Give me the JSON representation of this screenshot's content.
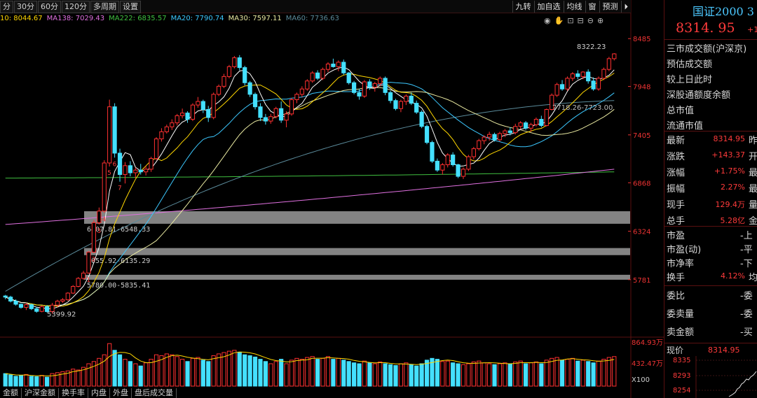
{
  "toolbar": {
    "left_buttons": [
      "分",
      "30分",
      "60分",
      "120分",
      "多周期",
      "设置"
    ],
    "right_buttons": [
      "九转",
      "加自选",
      "均线",
      "窗",
      "预测",
      "⏵"
    ]
  },
  "ma_legend": [
    {
      "label": "10: 8044.67",
      "color": "#ffd700"
    },
    {
      "label": "MA138: 7029.43",
      "color": "#e070e0"
    },
    {
      "label": "MA222: 6835.57",
      "color": "#40c040"
    },
    {
      "label": "MA20: 7790.74",
      "color": "#3cc8ff"
    },
    {
      "label": "MA30: 7597.11",
      "color": "#e8e8a0"
    },
    {
      "label": "MA60: 7736.63",
      "color": "#5a8a9a"
    }
  ],
  "chart_icons": [
    "eye-icon",
    "hand-icon",
    "lock-icon",
    "shrink-icon",
    "zoom-out-icon",
    "zoom-in-icon"
  ],
  "price_axis": [
    "8485",
    "7948",
    "7405",
    "6868",
    "6324",
    "5781"
  ],
  "volume_axis": [
    "864.93万",
    "432.47万",
    "X100"
  ],
  "annotations": {
    "high": "8322.23",
    "low": "5399.92",
    "gap1": "6407.81-6548.33",
    "gap2": "6055.92-6135.29",
    "gap3": "5780.00-5835.41",
    "gap_top": "7718.26-7723.00"
  },
  "bottom_tabs": [
    "金额",
    "沪深金额",
    "换手率",
    "内盘",
    "外盘",
    "盘后成交量"
  ],
  "panel": {
    "title": "国证2000 3",
    "price": "8314. 95",
    "change_small": "+1",
    "rows_top": [
      "三市成交额(沪深京)",
      "预估成交额",
      "较上日此时",
      "深股通额度余额",
      "总市值",
      "流通市值"
    ],
    "quote_rows": [
      {
        "label": "最新",
        "value": "8314.95",
        "tail": "昨"
      },
      {
        "label": "涨跌",
        "value": "+143.37",
        "tail": "开"
      },
      {
        "label": "涨幅",
        "value": "+1.75%",
        "tail": "最"
      },
      {
        "label": "振幅",
        "value": "2.27%",
        "tail": "最"
      },
      {
        "label": "现手",
        "value": "129.4万",
        "tail": "量"
      },
      {
        "label": "总手",
        "value": "5.28亿",
        "tail": "金"
      }
    ],
    "ratio_rows": [
      {
        "label": "市盈",
        "tail": "上"
      },
      {
        "label": "市盈(动)",
        "tail": "平"
      },
      {
        "label": "市净率",
        "tail": "下"
      },
      {
        "label": "换手",
        "value": "4.12%",
        "tail": "均"
      }
    ],
    "order_rows": [
      {
        "label": "委比",
        "tail": "委"
      },
      {
        "label": "委卖量",
        "tail": "委"
      },
      {
        "label": "卖金额",
        "tail": "买"
      }
    ],
    "mini": {
      "label": "现价",
      "value": "8314.95",
      "axis": [
        "8335",
        "8293",
        "8254"
      ]
    }
  },
  "chart_data": {
    "type": "candlestick",
    "price_range": [
      5230,
      8620
    ],
    "candles": [
      [
        5598,
        5610,
        5560,
        5585
      ],
      [
        5585,
        5600,
        5525,
        5540
      ],
      [
        5540,
        5560,
        5490,
        5505
      ],
      [
        5505,
        5515,
        5455,
        5470
      ],
      [
        5470,
        5520,
        5440,
        5500
      ],
      [
        5500,
        5510,
        5440,
        5455
      ],
      [
        5455,
        5475,
        5410,
        5425
      ],
      [
        5425,
        5490,
        5415,
        5478
      ],
      [
        5478,
        5495,
        5410,
        5423
      ],
      [
        5423,
        5520,
        5400,
        5495
      ],
      [
        5495,
        5555,
        5470,
        5540
      ],
      [
        5540,
        5575,
        5520,
        5555
      ],
      [
        5555,
        5640,
        5545,
        5630
      ],
      [
        5630,
        5720,
        5620,
        5705
      ],
      [
        5705,
        5810,
        5695,
        5795
      ],
      [
        5795,
        5880,
        5780,
        5855
      ],
      [
        5855,
        6100,
        5850,
        6090
      ],
      [
        6090,
        6450,
        6080,
        6420
      ],
      [
        6420,
        6590,
        6400,
        6550
      ],
      [
        6550,
        7120,
        6530,
        7090
      ],
      [
        7090,
        7800,
        7050,
        7720
      ],
      [
        7720,
        7760,
        7150,
        7200
      ],
      [
        7200,
        7250,
        6880,
        6960
      ],
      [
        6960,
        7100,
        6860,
        7060
      ],
      [
        7060,
        7110,
        6940,
        6980
      ],
      [
        6980,
        7040,
        6920,
        7010
      ],
      [
        7010,
        7080,
        6960,
        6990
      ],
      [
        6990,
        7060,
        6950,
        7020
      ],
      [
        7020,
        7160,
        6990,
        7140
      ],
      [
        7140,
        7380,
        7120,
        7360
      ],
      [
        7360,
        7480,
        7330,
        7440
      ],
      [
        7440,
        7520,
        7420,
        7495
      ],
      [
        7495,
        7580,
        7460,
        7540
      ],
      [
        7540,
        7640,
        7510,
        7620
      ],
      [
        7620,
        7700,
        7590,
        7650
      ],
      [
        7650,
        7670,
        7540,
        7580
      ],
      [
        7580,
        7760,
        7560,
        7740
      ],
      [
        7740,
        7830,
        7710,
        7780
      ],
      [
        7780,
        7800,
        7650,
        7690
      ],
      [
        7690,
        7730,
        7550,
        7600
      ],
      [
        7600,
        7880,
        7580,
        7860
      ],
      [
        7860,
        7970,
        7840,
        7950
      ],
      [
        7950,
        8090,
        7930,
        8060
      ],
      [
        8060,
        8190,
        8040,
        8170
      ],
      [
        8170,
        8290,
        8150,
        8270
      ],
      [
        8270,
        8300,
        8130,
        8160
      ],
      [
        8160,
        8180,
        7960,
        7990
      ],
      [
        7990,
        8010,
        7830,
        7860
      ],
      [
        7860,
        7880,
        7690,
        7720
      ],
      [
        7720,
        7760,
        7560,
        7600
      ],
      [
        7600,
        7640,
        7520,
        7560
      ],
      [
        7560,
        7640,
        7530,
        7610
      ],
      [
        7610,
        7720,
        7590,
        7700
      ],
      [
        7700,
        7780,
        7540,
        7570
      ],
      [
        7570,
        7670,
        7490,
        7640
      ],
      [
        7640,
        7820,
        7620,
        7800
      ],
      [
        7800,
        7880,
        7760,
        7860
      ],
      [
        7860,
        7950,
        7830,
        7920
      ],
      [
        7920,
        8030,
        7900,
        8010
      ],
      [
        8010,
        8120,
        7990,
        8100
      ],
      [
        8100,
        8130,
        8020,
        8040
      ],
      [
        8040,
        8160,
        8020,
        8140
      ],
      [
        8140,
        8220,
        8110,
        8200
      ],
      [
        8200,
        8260,
        8160,
        8170
      ],
      [
        8170,
        8240,
        8120,
        8220
      ],
      [
        8220,
        8250,
        8080,
        8100
      ],
      [
        8100,
        8110,
        7970,
        7990
      ],
      [
        7990,
        8010,
        7860,
        7880
      ],
      [
        7880,
        7920,
        7800,
        7840
      ],
      [
        7840,
        8020,
        7820,
        8000
      ],
      [
        8000,
        8030,
        7910,
        7940
      ],
      [
        7940,
        8000,
        7890,
        7980
      ],
      [
        7980,
        8060,
        7950,
        8040
      ],
      [
        8040,
        8060,
        7850,
        7880
      ],
      [
        7880,
        7900,
        7760,
        7790
      ],
      [
        7790,
        7810,
        7680,
        7700
      ],
      [
        7700,
        7800,
        7660,
        7780
      ],
      [
        7780,
        7860,
        7740,
        7840
      ],
      [
        7840,
        7880,
        7740,
        7760
      ],
      [
        7760,
        7790,
        7640,
        7660
      ],
      [
        7660,
        7680,
        7480,
        7500
      ],
      [
        7500,
        7520,
        7300,
        7320
      ],
      [
        7320,
        7340,
        7090,
        7110
      ],
      [
        7110,
        7140,
        6990,
        7010
      ],
      [
        7010,
        7090,
        6960,
        7070
      ],
      [
        7070,
        7200,
        7040,
        7180
      ],
      [
        7180,
        7210,
        7050,
        7070
      ],
      [
        7070,
        7080,
        6920,
        6940
      ],
      [
        6940,
        7040,
        6910,
        7020
      ],
      [
        7020,
        7180,
        7000,
        7160
      ],
      [
        7160,
        7270,
        7130,
        7250
      ],
      [
        7250,
        7360,
        7230,
        7340
      ],
      [
        7340,
        7400,
        7300,
        7380
      ],
      [
        7380,
        7440,
        7340,
        7410
      ],
      [
        7410,
        7430,
        7330,
        7350
      ],
      [
        7350,
        7440,
        7330,
        7420
      ],
      [
        7420,
        7470,
        7380,
        7450
      ],
      [
        7450,
        7490,
        7400,
        7430
      ],
      [
        7430,
        7530,
        7410,
        7500
      ],
      [
        7500,
        7560,
        7470,
        7540
      ],
      [
        7540,
        7560,
        7460,
        7480
      ],
      [
        7480,
        7540,
        7440,
        7520
      ],
      [
        7520,
        7600,
        7500,
        7580
      ],
      [
        7580,
        7620,
        7490,
        7510
      ],
      [
        7510,
        7700,
        7500,
        7690
      ],
      [
        7690,
        7870,
        7680,
        7850
      ],
      [
        7850,
        7990,
        7830,
        7970
      ],
      [
        7970,
        8020,
        7900,
        7920
      ],
      [
        7920,
        8060,
        7900,
        8040
      ],
      [
        8040,
        8110,
        8010,
        8090
      ],
      [
        8090,
        8130,
        8030,
        8060
      ],
      [
        8060,
        8120,
        8030,
        8110
      ],
      [
        8110,
        8140,
        7980,
        8010
      ],
      [
        8010,
        8050,
        7900,
        7920
      ],
      [
        7920,
        8060,
        7900,
        8040
      ],
      [
        8040,
        8160,
        8020,
        8140
      ],
      [
        8140,
        8280,
        8120,
        8260
      ],
      [
        8260,
        8322,
        8240,
        8314
      ]
    ],
    "volumes": [
      0.28,
      0.25,
      0.22,
      0.24,
      0.26,
      0.22,
      0.21,
      0.24,
      0.2,
      0.28,
      0.3,
      0.32,
      0.34,
      0.38,
      0.36,
      0.42,
      0.5,
      0.55,
      0.62,
      0.7,
      0.95,
      0.8,
      0.7,
      0.6,
      0.55,
      0.5,
      0.45,
      0.52,
      0.6,
      0.7,
      0.68,
      0.72,
      0.7,
      0.66,
      0.6,
      0.55,
      0.62,
      0.64,
      0.58,
      0.55,
      0.68,
      0.72,
      0.75,
      0.78,
      0.8,
      0.76,
      0.7,
      0.68,
      0.65,
      0.6,
      0.55,
      0.5,
      0.55,
      0.6,
      0.5,
      0.58,
      0.62,
      0.6,
      0.64,
      0.66,
      0.6,
      0.62,
      0.66,
      0.6,
      0.62,
      0.58,
      0.55,
      0.52,
      0.5,
      0.56,
      0.52,
      0.5,
      0.54,
      0.5,
      0.48,
      0.46,
      0.5,
      0.52,
      0.48,
      0.45,
      0.5,
      0.58,
      0.62,
      0.6,
      0.55,
      0.56,
      0.52,
      0.5,
      0.48,
      0.5,
      0.54,
      0.56,
      0.52,
      0.5,
      0.48,
      0.5,
      0.52,
      0.5,
      0.54,
      0.56,
      0.5,
      0.52,
      0.54,
      0.5,
      0.58,
      0.62,
      0.64,
      0.58,
      0.6,
      0.62,
      0.56,
      0.58,
      0.55,
      0.52,
      0.56,
      0.6,
      0.64,
      0.66
    ],
    "gaps": [
      [
        6407.81,
        6548.33
      ],
      [
        6055.92,
        6135.29
      ],
      [
        5780.0,
        5835.41
      ]
    ]
  }
}
